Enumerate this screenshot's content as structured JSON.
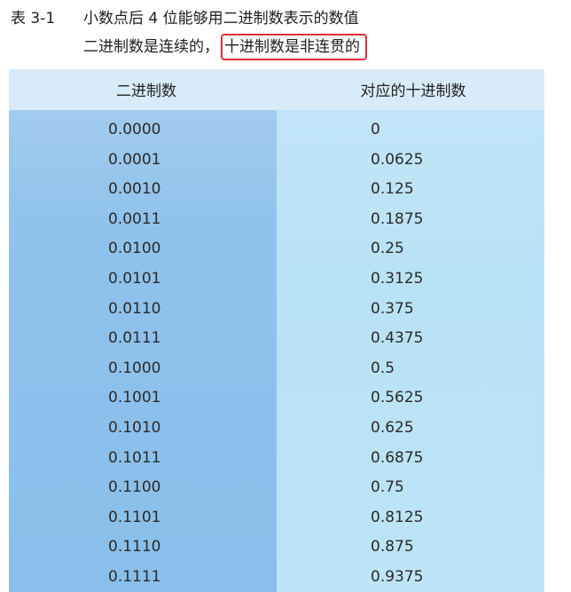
{
  "caption": {
    "label": "表 3-1",
    "title": "小数点后 4 位能够用二进制数表示的数值",
    "note_plain": "二进制数是连续的，",
    "note_highlight": "十进制数是非连贯的"
  },
  "table": {
    "headers": [
      "二进制数",
      "对应的十进制数"
    ],
    "rows": [
      [
        "0.0000",
        "0"
      ],
      [
        "0.0001",
        "0.0625"
      ],
      [
        "0.0010",
        "0.125"
      ],
      [
        "0.0011",
        "0.1875"
      ],
      [
        "0.0100",
        "0.25"
      ],
      [
        "0.0101",
        "0.3125"
      ],
      [
        "0.0110",
        "0.375"
      ],
      [
        "0.0111",
        "0.4375"
      ],
      [
        "0.1000",
        "0.5"
      ],
      [
        "0.1001",
        "0.5625"
      ],
      [
        "0.1010",
        "0.625"
      ],
      [
        "0.1011",
        "0.6875"
      ],
      [
        "0.1100",
        "0.75"
      ],
      [
        "0.1101",
        "0.8125"
      ],
      [
        "0.1110",
        "0.875"
      ],
      [
        "0.1111",
        "0.9375"
      ]
    ]
  },
  "colors": {
    "highlight_border": "#e0303a",
    "left_column": "#8fc2ec",
    "right_column": "#bde4f7"
  }
}
